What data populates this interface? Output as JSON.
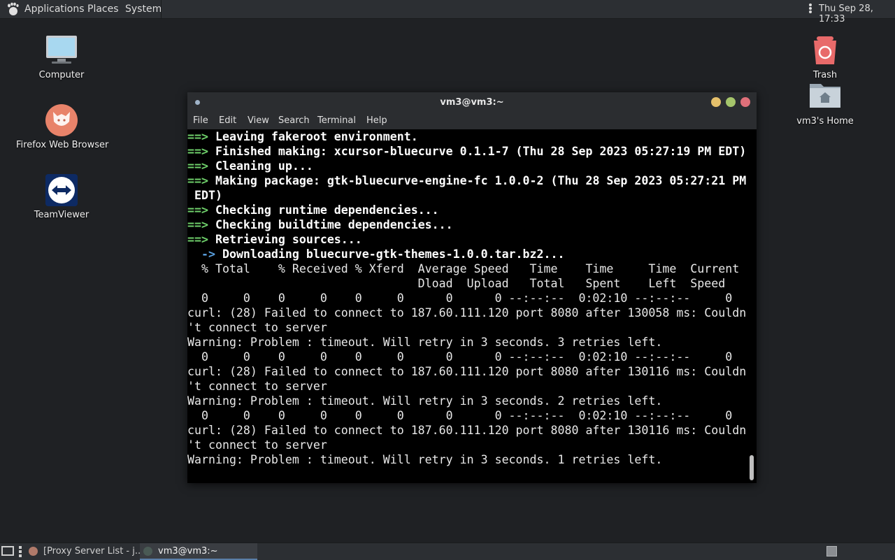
{
  "top_panel": {
    "applications": "Applications",
    "places": "Places",
    "system": "System",
    "clock": "Thu Sep 28, 17:33"
  },
  "desktop": {
    "computer": "Computer",
    "firefox": "Firefox Web Browser",
    "teamviewer": "TeamViewer",
    "trash": "Trash",
    "home": "vm3's Home"
  },
  "terminal": {
    "title": "vm3@vm3:~",
    "menu": [
      "File",
      "Edit",
      "View",
      "Search",
      "Terminal",
      "Help"
    ],
    "lines": [
      {
        "arrow": "==>",
        "text": " Leaving fakeroot environment."
      },
      {
        "arrow": "==>",
        "text": " Finished making: xcursor-bluecurve 0.1.1-7 (Thu 28 Sep 2023 05:27:19 PM EDT)"
      },
      {
        "arrow": "==>",
        "text": " Cleaning up..."
      },
      {
        "arrow": "==>",
        "text": " Making package: gtk-bluecurve-engine-fc 1.0.0-2 (Thu 28 Sep 2023 05:27:21 PM"
      },
      {
        "plainbold": " EDT)"
      },
      {
        "arrow": "==>",
        "text": " Checking runtime dependencies..."
      },
      {
        "arrow": "==>",
        "text": " Checking buildtime dependencies..."
      },
      {
        "arrow": "==>",
        "text": " Retrieving sources..."
      },
      {
        "sub": "  ->",
        "text": " Downloading bluecurve-gtk-themes-1.0.0.tar.bz2..."
      },
      {
        "plain": "  % Total    % Received % Xferd  Average Speed   Time    Time     Time  Current"
      },
      {
        "plain": "                                 Dload  Upload   Total   Spent    Left  Speed"
      },
      {
        "plain": "  0     0    0     0    0     0      0      0 --:--:--  0:02:10 --:--:--     0"
      },
      {
        "plain": "curl: (28) Failed to connect to 187.60.111.120 port 8080 after 130058 ms: Couldn"
      },
      {
        "plain": "'t connect to server"
      },
      {
        "plain": "Warning: Problem : timeout. Will retry in 3 seconds. 3 retries left."
      },
      {
        "plain": "  0     0    0     0    0     0      0      0 --:--:--  0:02:10 --:--:--     0"
      },
      {
        "plain": "curl: (28) Failed to connect to 187.60.111.120 port 8080 after 130116 ms: Couldn"
      },
      {
        "plain": "'t connect to server"
      },
      {
        "plain": "Warning: Problem : timeout. Will retry in 3 seconds. 2 retries left."
      },
      {
        "plain": "  0     0    0     0    0     0      0      0 --:--:--  0:02:10 --:--:--     0"
      },
      {
        "plain": "curl: (28) Failed to connect to 187.60.111.120 port 8080 after 130116 ms: Couldn"
      },
      {
        "plain": "'t connect to server"
      },
      {
        "plain": "Warning: Problem : timeout. Will retry in 3 seconds. 1 retries left."
      }
    ]
  },
  "taskbar": {
    "task1": "[Proxy Server List - j...",
    "task2": "vm3@vm3:~"
  },
  "colors": {
    "arrow": "#6fd16b",
    "sub_arrow": "#5aa0e0",
    "close": "#e0707a",
    "minimize": "#e5c06b",
    "maximize": "#a5c56b"
  }
}
